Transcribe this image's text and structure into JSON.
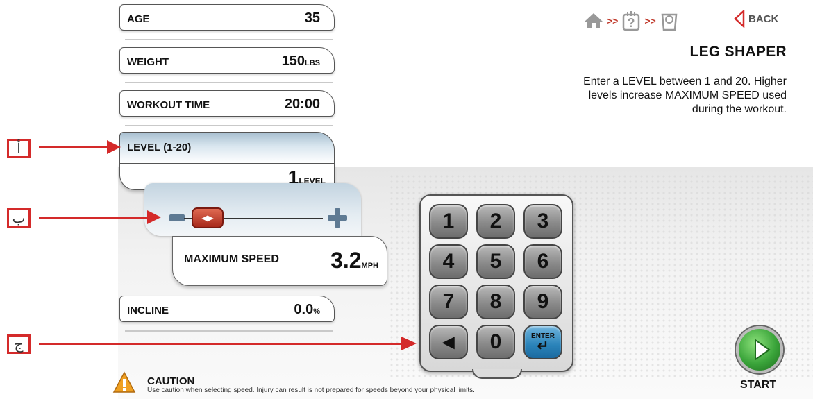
{
  "fields": {
    "age": {
      "label": "AGE",
      "value": "35"
    },
    "weight": {
      "label": "WEIGHT",
      "value": "150",
      "unit": "LBS"
    },
    "workout_time": {
      "label": "WORKOUT TIME",
      "value": "20:00"
    },
    "level": {
      "label": "LEVEL (1-20)",
      "value": "1",
      "unit": "LEVEL"
    },
    "max_speed": {
      "label": "MAXIMUM SPEED",
      "value": "3.2",
      "unit": "MPH"
    },
    "incline": {
      "label": "INCLINE",
      "value": "0.0",
      "unit": "%"
    }
  },
  "slider": {
    "minus": "−",
    "plus": "+",
    "thumb": "◂▸"
  },
  "keypad": {
    "keys": [
      "1",
      "2",
      "3",
      "4",
      "5",
      "6",
      "7",
      "8",
      "9",
      "◀",
      "0"
    ],
    "enter_label": "ENTER",
    "enter_arrow": "↵"
  },
  "nav": {
    "back_label": "BACK",
    "sep": ">>"
  },
  "program": {
    "title": "LEG SHAPER",
    "description": "Enter a LEVEL between 1 and 20. Higher levels increase MAXIMUM SPEED used during the workout."
  },
  "start_label": "START",
  "caution": {
    "title": "CAUTION",
    "text": "Use caution when selecting speed. Injury can result is not prepared for speeds beyond your physical limits."
  },
  "annotations": {
    "a": "أ",
    "b": "ب",
    "c": "ج"
  },
  "colors": {
    "accent": "#d42a2a",
    "enter": "#2a83b9",
    "start": "#3aa43a",
    "slider": "#5e7a93"
  }
}
